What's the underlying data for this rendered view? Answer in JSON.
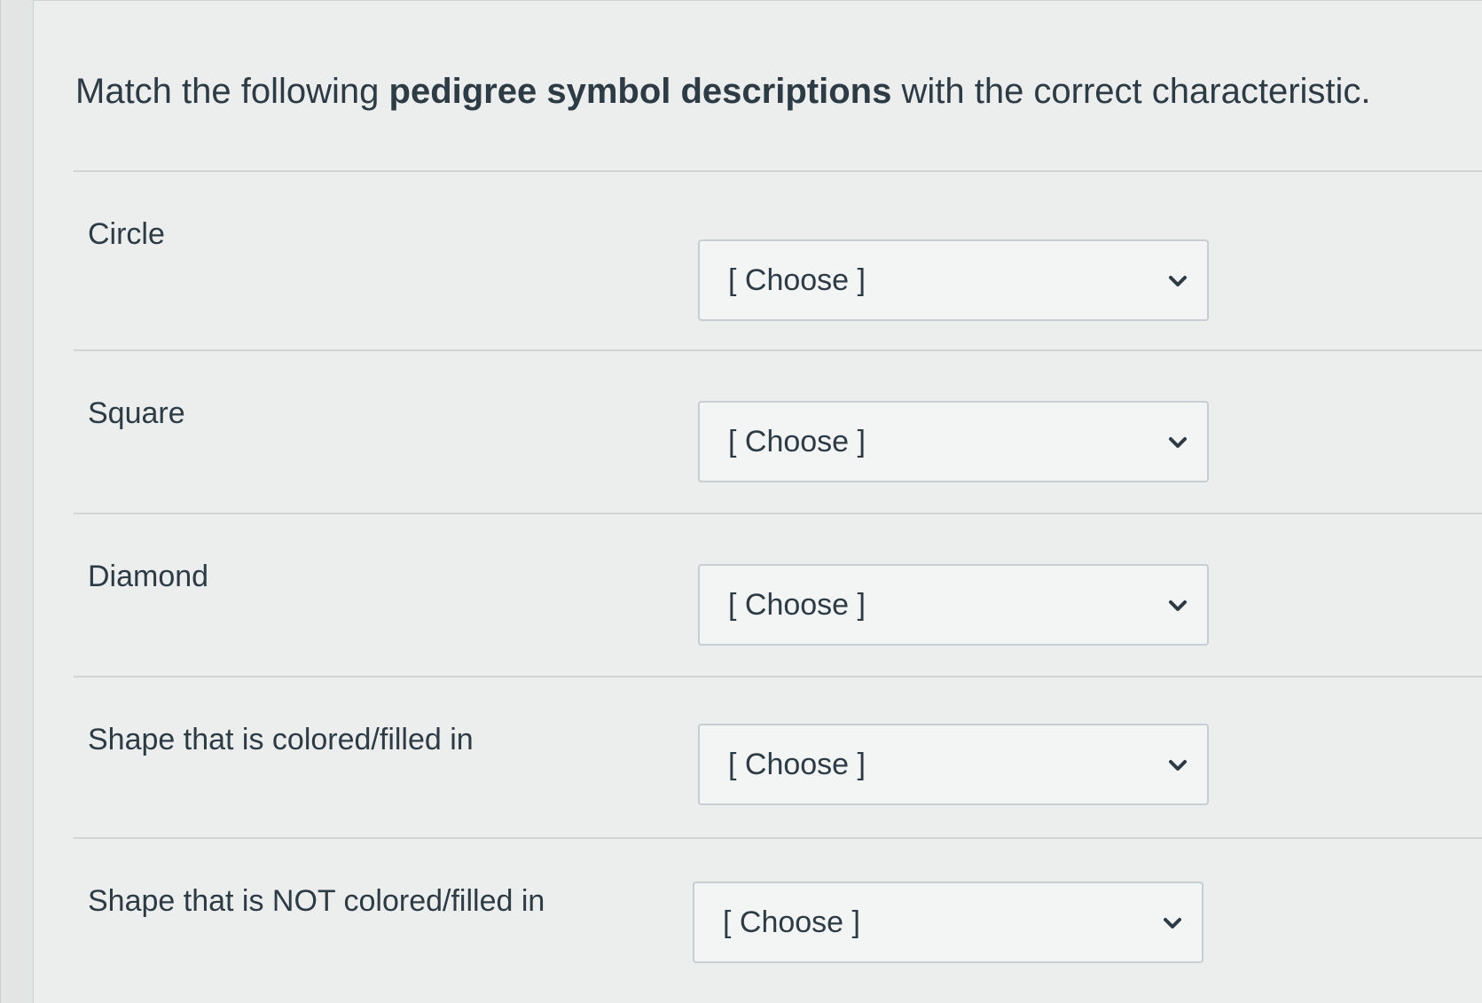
{
  "question": {
    "prefix": "Match the following ",
    "emphasis": "pedigree symbol descriptions",
    "suffix": " with the correct characteristic."
  },
  "rows": [
    {
      "label": "Circle",
      "selected": "[ Choose ]"
    },
    {
      "label": "Square",
      "selected": "[ Choose ]"
    },
    {
      "label": "Diamond",
      "selected": "[ Choose ]"
    },
    {
      "label": "Shape that is colored/filled in",
      "selected": "[ Choose ]"
    },
    {
      "label": "Shape that is NOT colored/filled in",
      "selected": "[ Choose ]"
    }
  ],
  "icons": {
    "dropdown": "chevron-down-icon"
  },
  "colors": {
    "text": "#2d3b45",
    "border": "#c7cdd1"
  }
}
